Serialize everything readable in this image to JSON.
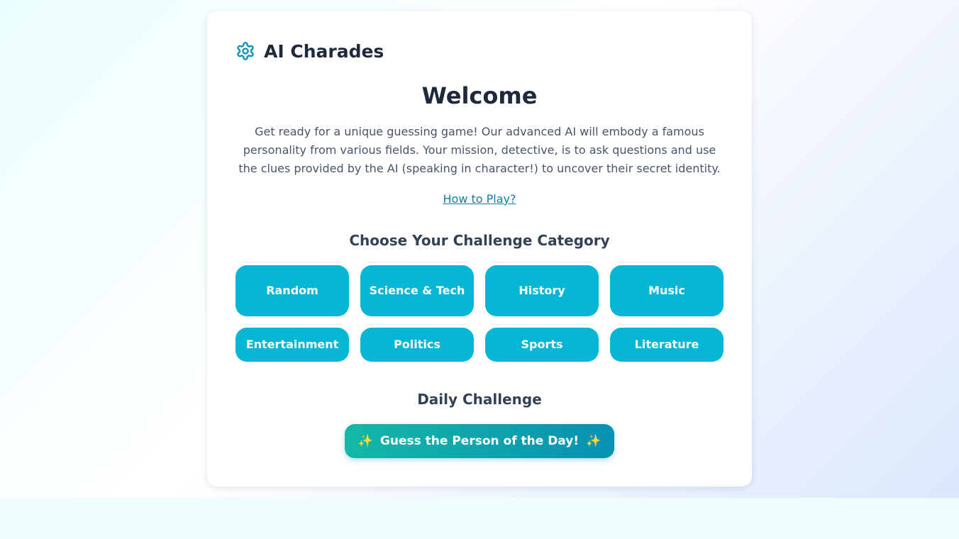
{
  "app": {
    "title": "AI Charades",
    "logo_icon": "gear-icon",
    "accent_color": "#06b6d4"
  },
  "welcome": {
    "heading": "Welcome",
    "intro": "Get ready for a unique guessing game! Our advanced AI will embody a famous personality from various fields. Your mission, detective, is to ask questions and use the clues provided by the AI (speaking in character!) to uncover their secret identity.",
    "how_to_link": "How to Play?"
  },
  "categories": {
    "heading": "Choose Your Challenge Category",
    "items": [
      {
        "label": "Random"
      },
      {
        "label": "Science & Tech"
      },
      {
        "label": "History"
      },
      {
        "label": "Music"
      },
      {
        "label": "Entertainment"
      },
      {
        "label": "Politics"
      },
      {
        "label": "Sports"
      },
      {
        "label": "Literature"
      }
    ]
  },
  "daily": {
    "heading": "Daily Challenge",
    "button_label": "Guess the Person of the Day!",
    "button_icon": "sparkle-icon",
    "button_gradient": [
      "#14b8a6",
      "#0891b2"
    ]
  }
}
